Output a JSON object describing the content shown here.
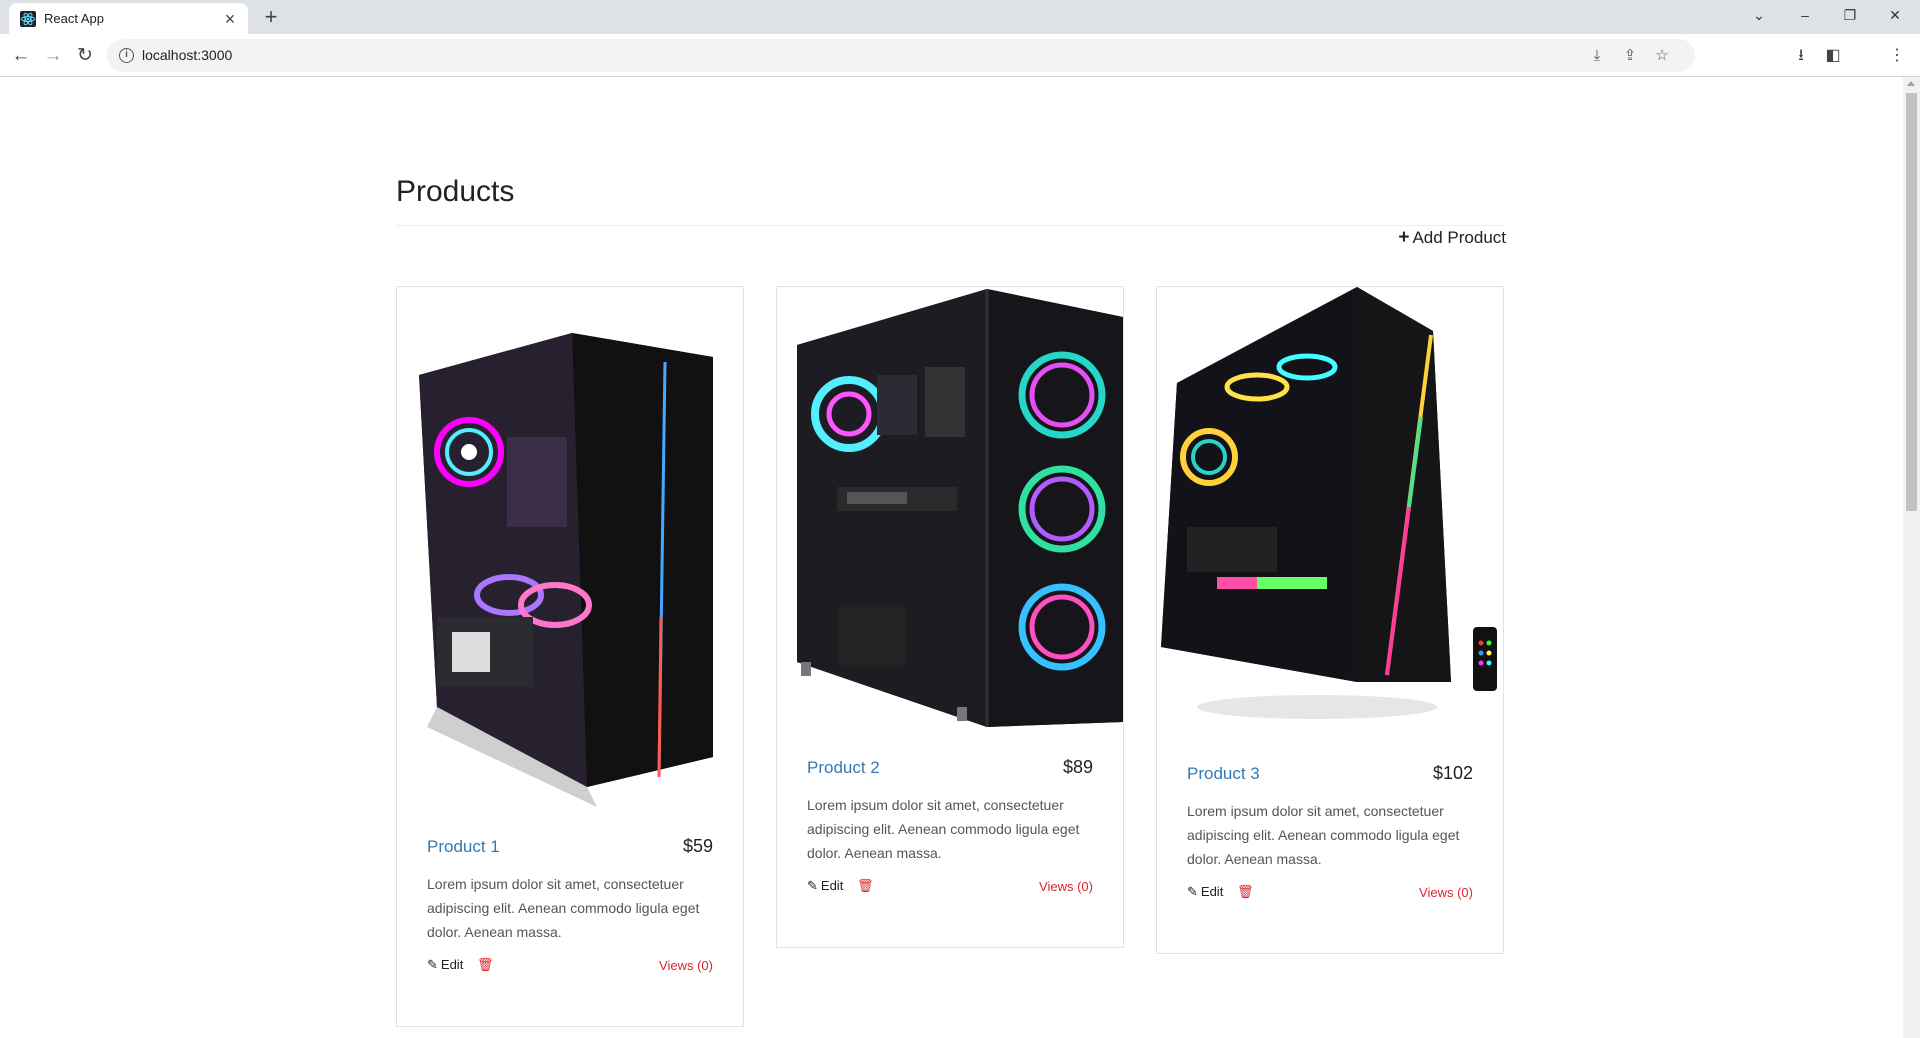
{
  "browser": {
    "tab_title": "React App",
    "url": "localhost:3000"
  },
  "page": {
    "title": "Products",
    "add_label": "Add Product"
  },
  "products": [
    {
      "name": "Product 1",
      "price": "$59",
      "description": "Lorem ipsum dolor sit amet, consectetuer adipiscing elit. Aenean commodo ligula eget dolor. Aenean massa.",
      "edit_label": "Edit",
      "views_label": "Views (0)",
      "accent": "#8a3cff"
    },
    {
      "name": "Product 2",
      "price": "$89",
      "description": "Lorem ipsum dolor sit amet, consectetuer adipiscing elit. Aenean commodo ligula eget dolor. Aenean massa.",
      "edit_label": "Edit",
      "views_label": "Views (0)",
      "accent": "#2ad4c4"
    },
    {
      "name": "Product 3",
      "price": "$102",
      "description": "Lorem ipsum dolor sit amet, consectetuer adipiscing elit. Aenean commodo ligula eget dolor. Aenean massa.",
      "edit_label": "Edit",
      "views_label": "Views (0)",
      "accent": "#ff3c9c"
    }
  ],
  "colors": {
    "link": "#337ab7",
    "danger": "#d9252e",
    "text": "#222222"
  }
}
